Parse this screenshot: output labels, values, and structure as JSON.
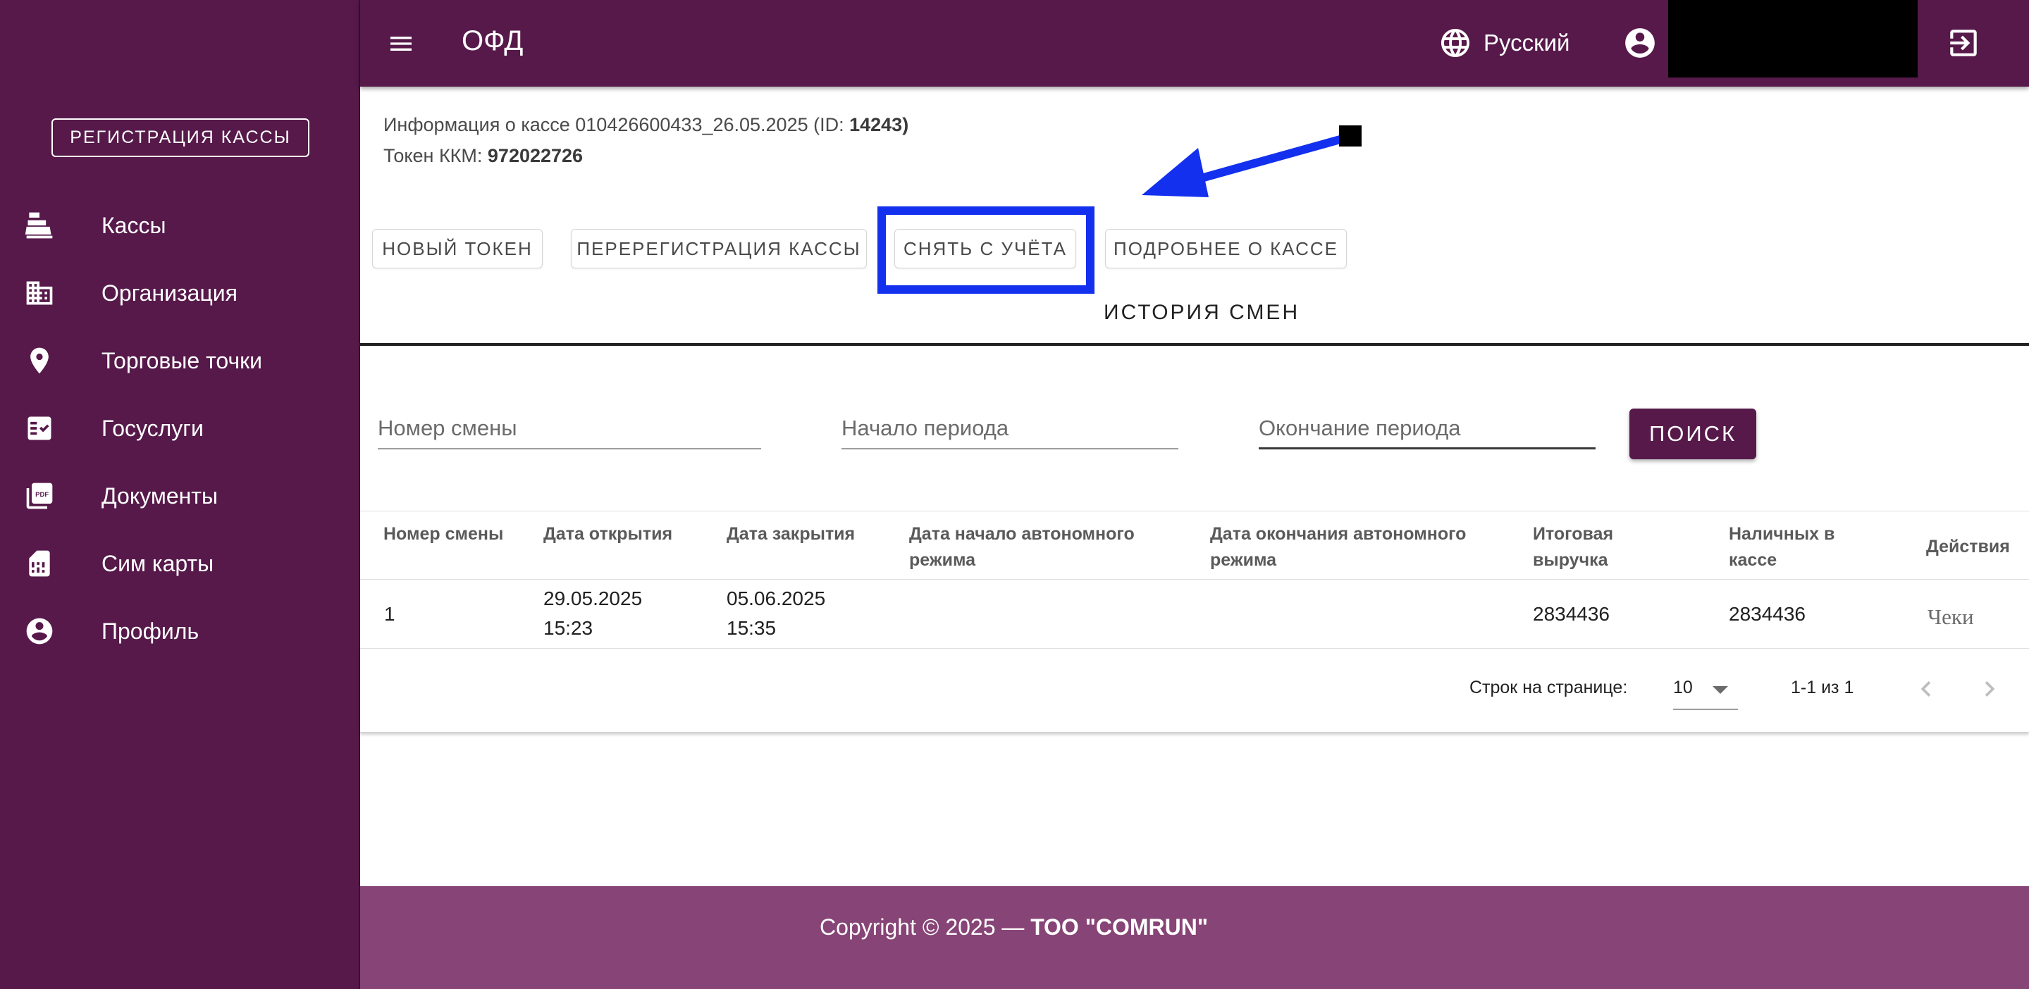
{
  "sidebar": {
    "register_button": "Регистрация кассы",
    "items": [
      {
        "label": "Кассы",
        "icon": "cash-register-icon"
      },
      {
        "label": "Организация",
        "icon": "building-icon"
      },
      {
        "label": "Торговые точки",
        "icon": "location-pin-icon"
      },
      {
        "label": "Госуслуги",
        "icon": "checklist-icon"
      },
      {
        "label": "Документы",
        "icon": "pdf-document-icon"
      },
      {
        "label": "Сим карты",
        "icon": "sim-card-icon"
      },
      {
        "label": "Профиль",
        "icon": "account-circle-icon"
      }
    ]
  },
  "header": {
    "title": "ОФД",
    "language": "Русский"
  },
  "info": {
    "kassa_prefix": "Информация о кассе 010426600433_26.05.2025 (ID: ",
    "kassa_id": "14243",
    "kassa_suffix": ")",
    "token_prefix": "Токен ККМ: ",
    "token_value": "972022726"
  },
  "actions": {
    "new_token": "Новый токен",
    "reregister": "Перерегистрация кассы",
    "deregister": "Снять с учёта",
    "details": "Подробнее о кассе"
  },
  "history_title": "История смен",
  "filters": {
    "shift_placeholder": "Номер смены",
    "start_placeholder": "Начало периода",
    "end_placeholder": "Окончание периода",
    "search_button": "Поиск"
  },
  "table": {
    "headers": [
      "Номер смены",
      "Дата открытия",
      "Дата закрытия",
      "Дата начало автономного режима",
      "Дата окончания автономного режима",
      "Итоговая выручка",
      "Наличных в кассе",
      "Действия"
    ],
    "rows": [
      {
        "shift": "1",
        "open_date": "29.05.2025",
        "open_time": "15:23",
        "close_date": "05.06.2025",
        "close_time": "15:35",
        "auto_start": "",
        "auto_end": "",
        "revenue": "2834436",
        "cash": "2834436",
        "action": "Чеки"
      }
    ]
  },
  "pagination": {
    "rows_label": "Строк на странице:",
    "rows_value": "10",
    "range": "1-1 из 1"
  },
  "footer": {
    "prefix": "Copyright © 2025 — ",
    "company": "ТОО \"COMRUN\""
  },
  "colors": {
    "brand": "#56194a",
    "footer": "#874476",
    "annotation": "#1230ee"
  }
}
